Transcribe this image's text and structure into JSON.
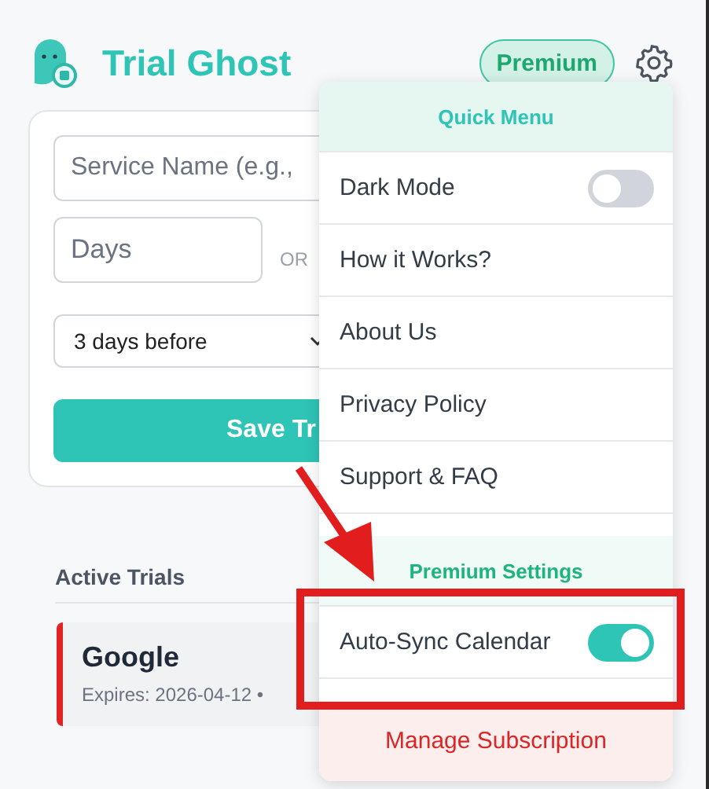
{
  "header": {
    "title": "Trial Ghost",
    "badge": "Premium"
  },
  "form": {
    "service_placeholder": "Service Name (e.g.,",
    "days_placeholder": "Days",
    "or_label": "OR",
    "reminder": "3 days before",
    "save_button": "Save Tr"
  },
  "trials": {
    "heading": "Active Trials",
    "items": [
      {
        "name": "Google",
        "meta": "Expires: 2026-04-12 •"
      }
    ]
  },
  "menu": {
    "title": "Quick Menu",
    "items": [
      {
        "kind": "toggle",
        "label": "Dark Mode",
        "on": false
      },
      {
        "kind": "link",
        "label": "How it Works?"
      },
      {
        "kind": "link",
        "label": "About Us"
      },
      {
        "kind": "link",
        "label": "Privacy Policy"
      },
      {
        "kind": "link",
        "label": "Support & FAQ"
      }
    ],
    "premium_title": "Premium Settings",
    "premium_items": [
      {
        "kind": "toggle",
        "label": "Auto-Sync Calendar",
        "on": true
      }
    ],
    "footer": "Manage Subscription"
  }
}
